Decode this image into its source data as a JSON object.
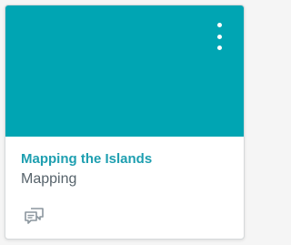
{
  "card": {
    "color": "#00a5b3",
    "title": "Mapping the Islands",
    "subtitle": "Mapping",
    "menu_icon": "more-vertical-icon",
    "action_icon": "discussions-icon"
  }
}
